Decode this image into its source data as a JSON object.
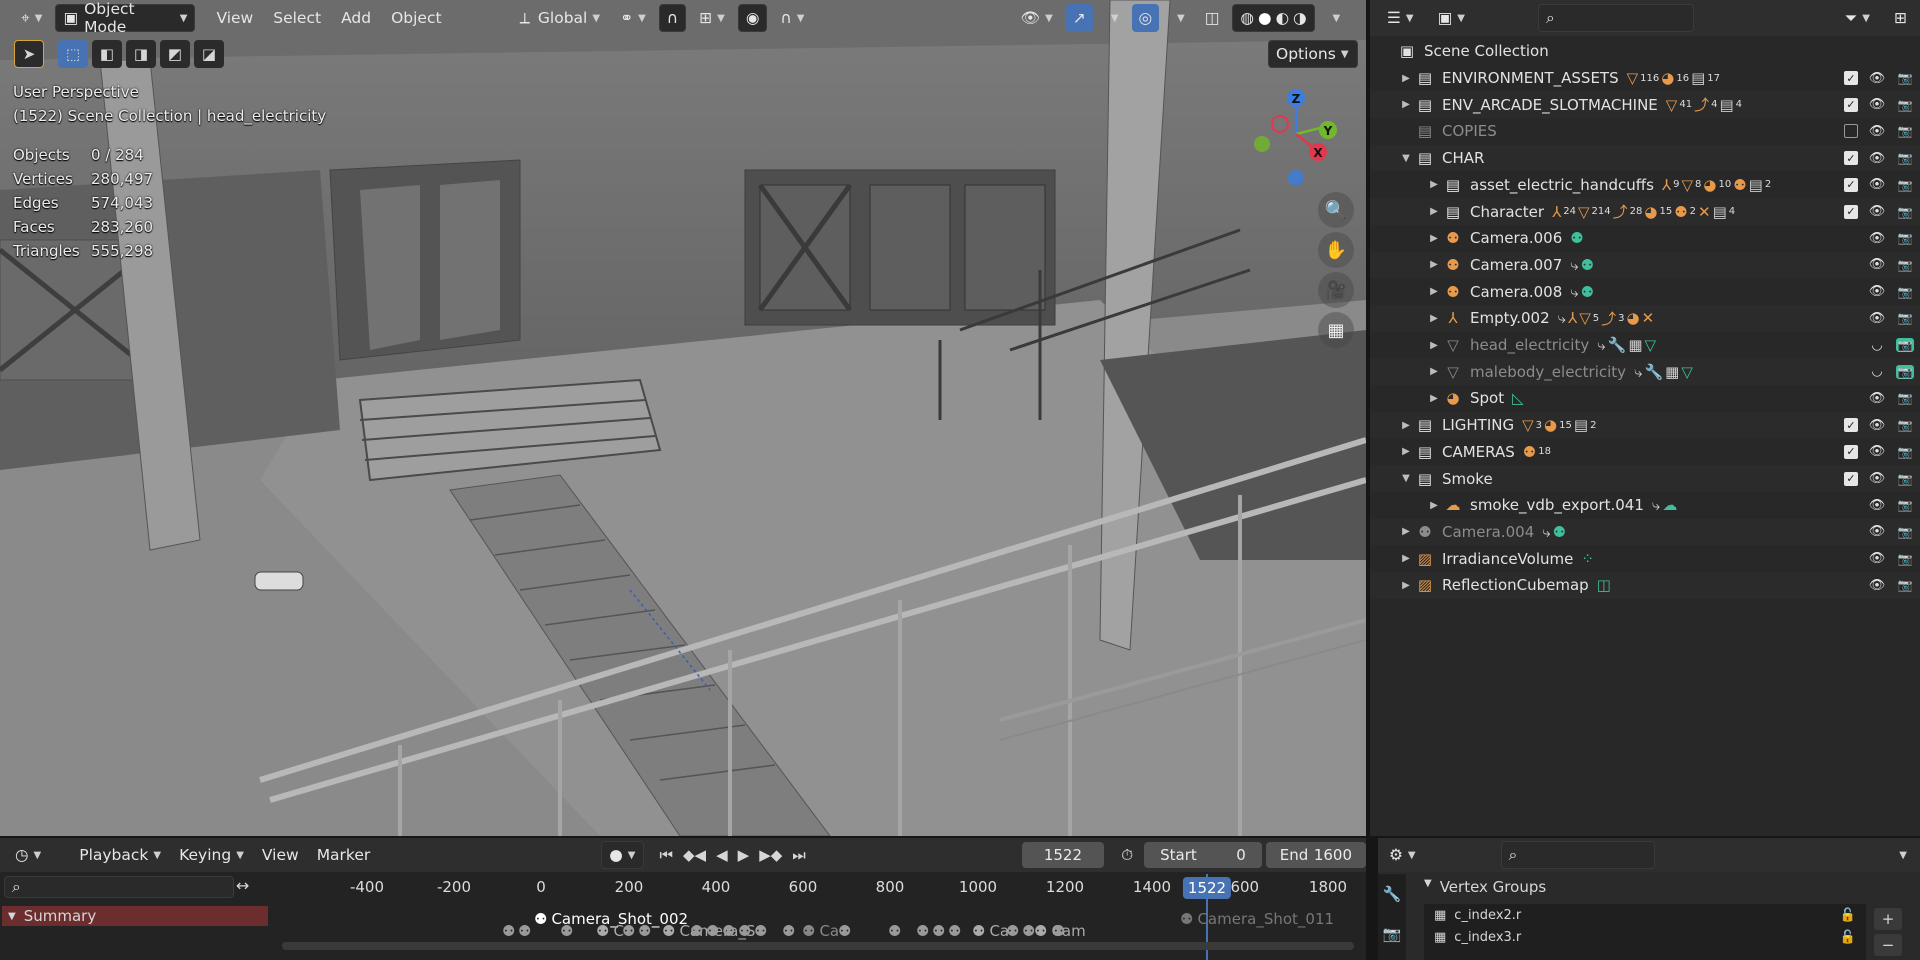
{
  "viewport": {
    "header": {
      "mode": "Object Mode",
      "menus": [
        "View",
        "Select",
        "Add",
        "Object"
      ],
      "orientation": "Global",
      "options_label": "Options"
    },
    "overlay": {
      "perspective": "User Perspective",
      "context": "(1522) Scene Collection | head_electricity",
      "stats": [
        {
          "k": "Objects",
          "v": "0 / 284"
        },
        {
          "k": "Vertices",
          "v": "280,497"
        },
        {
          "k": "Edges",
          "v": "574,043"
        },
        {
          "k": "Faces",
          "v": "283,260"
        },
        {
          "k": "Triangles",
          "v": "555,298"
        }
      ]
    },
    "gizmo": {
      "z": "Z",
      "y": "Y",
      "x": "X"
    }
  },
  "outliner": {
    "search_placeholder": "",
    "root": "Scene Collection",
    "rows": [
      {
        "label": "ENVIRONMENT_ASSETS",
        "indent": 1,
        "type": "collection",
        "arrow": "right",
        "checked": true,
        "tags": [
          [
            "o",
            "▽",
            "116"
          ],
          [
            "o",
            "◕",
            "16"
          ],
          [
            "w",
            "▤",
            "17"
          ]
        ]
      },
      {
        "label": "ENV_ARCADE_SLOTMACHINE",
        "indent": 1,
        "type": "collection",
        "arrow": "right",
        "checked": true,
        "tags": [
          [
            "o",
            "▽",
            "41"
          ],
          [
            "o",
            "⤴",
            "4"
          ],
          [
            "w",
            "▤",
            "4"
          ]
        ]
      },
      {
        "label": "COPIES",
        "indent": 1,
        "type": "collection",
        "arrow": "",
        "checked": false,
        "dim": true,
        "tags": []
      },
      {
        "label": "CHAR",
        "indent": 1,
        "type": "collection",
        "arrow": "down",
        "checked": true,
        "tags": []
      },
      {
        "label": "asset_electric_handcuffs",
        "indent": 2,
        "type": "collection",
        "arrow": "right",
        "checked": true,
        "tags": [
          [
            "o",
            "⅄",
            "9"
          ],
          [
            "o",
            "▽",
            "8"
          ],
          [
            "o",
            "◕",
            "10"
          ],
          [
            "o",
            "⚉",
            ""
          ],
          [
            "w",
            "▤",
            "2"
          ]
        ]
      },
      {
        "label": "Character",
        "indent": 2,
        "type": "collection",
        "arrow": "right",
        "checked": true,
        "tags": [
          [
            "o",
            "⅄",
            "24"
          ],
          [
            "o",
            "▽",
            "214"
          ],
          [
            "o",
            "⤴",
            "28"
          ],
          [
            "o",
            "◕",
            "15"
          ],
          [
            "o",
            "⚉",
            "2"
          ],
          [
            "o",
            "✕",
            ""
          ],
          [
            "w",
            "▤",
            "4"
          ]
        ]
      },
      {
        "label": "Camera.006",
        "indent": 2,
        "type": "camera",
        "arrow": "right",
        "tags": [
          [
            "g",
            "⚉",
            ""
          ]
        ]
      },
      {
        "label": "Camera.007",
        "indent": 2,
        "type": "camera",
        "arrow": "right",
        "tags": [
          [
            "w",
            "⤷",
            ""
          ],
          [
            "g",
            "⚉",
            ""
          ]
        ]
      },
      {
        "label": "Camera.008",
        "indent": 2,
        "type": "camera",
        "arrow": "right",
        "tags": [
          [
            "w",
            "⤷",
            ""
          ],
          [
            "g",
            "⚉",
            ""
          ]
        ]
      },
      {
        "label": "Empty.002",
        "indent": 2,
        "type": "empty",
        "arrow": "right",
        "tags": [
          [
            "w",
            "⤷",
            ""
          ],
          [
            "o",
            "⅄",
            ""
          ],
          [
            "o",
            "▽",
            "5"
          ],
          [
            "o",
            "⤴",
            "3"
          ],
          [
            "o",
            "◕",
            ""
          ],
          [
            "o",
            "✕",
            ""
          ]
        ]
      },
      {
        "label": "head_electricity",
        "indent": 2,
        "type": "mesh",
        "arrow": "right",
        "dim": true,
        "sel": true,
        "tags": [
          [
            "w",
            "⤷",
            ""
          ],
          [
            "b",
            "🔧",
            ""
          ],
          [
            "w",
            "▦",
            ""
          ],
          [
            "g",
            "▽",
            ""
          ]
        ]
      },
      {
        "label": "malebody_electricity",
        "indent": 2,
        "type": "mesh",
        "arrow": "right",
        "dim": true,
        "sel": true,
        "tags": [
          [
            "w",
            "⤷",
            ""
          ],
          [
            "b",
            "🔧",
            ""
          ],
          [
            "w",
            "▦",
            ""
          ],
          [
            "g",
            "▽",
            ""
          ]
        ]
      },
      {
        "label": "Spot",
        "indent": 2,
        "type": "light",
        "arrow": "right",
        "tags": [
          [
            "g",
            "◺",
            ""
          ]
        ]
      },
      {
        "label": "LIGHTING",
        "indent": 1,
        "type": "collection",
        "arrow": "right",
        "checked": true,
        "tags": [
          [
            "o",
            "▽",
            "3"
          ],
          [
            "o",
            "◕",
            "15"
          ],
          [
            "w",
            "▤",
            "2"
          ]
        ]
      },
      {
        "label": "CAMERAS",
        "indent": 1,
        "type": "collection",
        "arrow": "right",
        "checked": true,
        "tags": [
          [
            "o",
            "⚉",
            "18"
          ]
        ]
      },
      {
        "label": "Smoke",
        "indent": 1,
        "type": "collection",
        "arrow": "down",
        "checked": true,
        "tags": []
      },
      {
        "label": "smoke_vdb_export.041",
        "indent": 2,
        "type": "volume",
        "arrow": "right",
        "tags": [
          [
            "w",
            "⤷",
            ""
          ],
          [
            "g",
            "☁",
            ""
          ]
        ]
      },
      {
        "label": "Camera.004",
        "indent": 1,
        "type": "camera",
        "arrow": "right",
        "dim": true,
        "tags": [
          [
            "w",
            "⤷",
            ""
          ],
          [
            "g",
            "⚉",
            ""
          ]
        ]
      },
      {
        "label": "IrradianceVolume",
        "indent": 1,
        "type": "probe",
        "arrow": "right",
        "tags": [
          [
            "g",
            "⁘",
            ""
          ]
        ]
      },
      {
        "label": "ReflectionCubemap",
        "indent": 1,
        "type": "probe",
        "arrow": "right",
        "tags": [
          [
            "g",
            "◫",
            ""
          ]
        ]
      }
    ]
  },
  "timeline": {
    "menus": [
      "Playback",
      "Keying",
      "View",
      "Marker"
    ],
    "current_frame": "1522",
    "start_label": "Start",
    "start_value": "0",
    "end_label": "End",
    "end_value": "1600",
    "ruler": [
      "-400",
      "-200",
      "0",
      "200",
      "400",
      "600",
      "800",
      "1000",
      "1200",
      "1400",
      "1600",
      "1800"
    ],
    "summary_label": "Summary",
    "markers": [
      {
        "label": "Camera_Shot_002"
      },
      {
        "label": "C"
      },
      {
        "label": "Camera_S"
      },
      {
        "label": "Ca"
      },
      {
        "label": "Ca"
      },
      {
        "label": "Cam"
      },
      {
        "label": "Camera_Shot_011"
      }
    ]
  },
  "properties": {
    "panel_title": "Vertex Groups",
    "groups": [
      "c_index2.r",
      "c_index3.r"
    ]
  }
}
